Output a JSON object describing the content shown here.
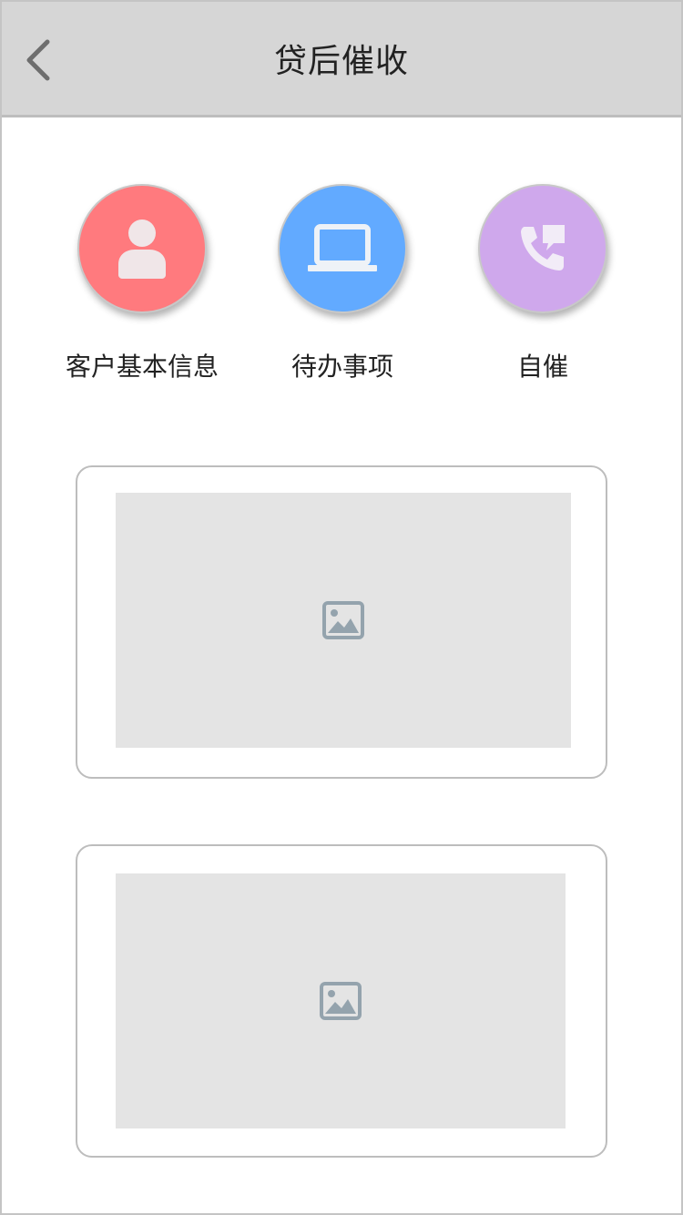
{
  "header": {
    "title": "贷后催收",
    "back_icon": "chevron-left-icon"
  },
  "shortcuts": [
    {
      "label": "客户基本信息",
      "icon": "user-icon",
      "color": "#ff7a7e"
    },
    {
      "label": "待办事项",
      "icon": "laptop-icon",
      "color": "#62aaff"
    },
    {
      "label": "自催",
      "icon": "phone-chat-icon",
      "color": "#cfa8ec"
    }
  ],
  "banners": [
    {
      "icon": "image-placeholder-icon"
    },
    {
      "icon": "image-placeholder-icon"
    }
  ],
  "colors": {
    "header_bg": "#d6d6d6",
    "placeholder_bg": "#e4e4e4",
    "placeholder_icon": "#94a3ad"
  }
}
